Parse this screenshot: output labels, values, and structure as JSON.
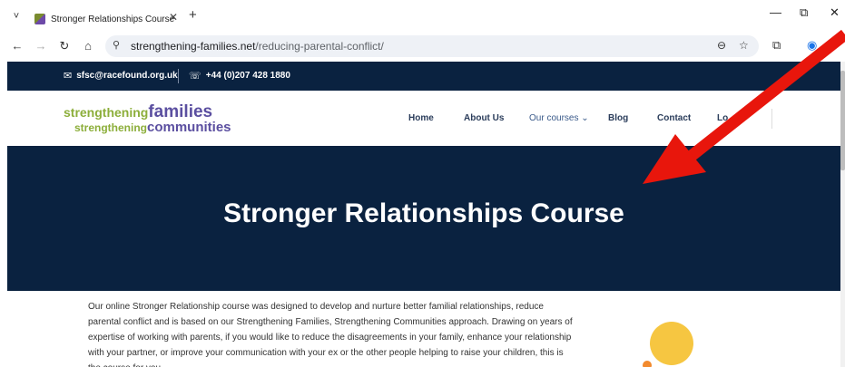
{
  "browser": {
    "tab_list_glyph": "˅",
    "tab_title": "Stronger Relationships Course",
    "tab_close_glyph": "✕",
    "new_tab_glyph": "+",
    "window_controls": {
      "minimize": "—",
      "restore": "⧉",
      "close": "✕"
    },
    "nav": {
      "back": "←",
      "forward": "→",
      "reload": "↻",
      "home": "⌂"
    },
    "site_info_glyph": "⚲",
    "url_host": "strengthening-families.net",
    "url_path": "/reducing-parental-conflict/",
    "zoom_glyph": "⊖",
    "bookmark_glyph": "☆",
    "extensions_glyph": "⧉",
    "profile_glyph": "◉"
  },
  "topbar": {
    "email": "sfsc@racefound.org.uk",
    "phone": "+44 (0)207 428 1880",
    "email_icon": "✉",
    "phone_icon": "☏"
  },
  "logo": {
    "line1_a": "strengthening",
    "line1_b": "families",
    "line2_a": "strengthening",
    "line2_b": "communities"
  },
  "nav": {
    "home": "Home",
    "about": "About Us",
    "courses": "Our courses",
    "courses_chevron": "⌄",
    "blog": "Blog",
    "contact": "Contact",
    "login": "Lo"
  },
  "hero": {
    "title": "Stronger Relationships Course"
  },
  "body": {
    "paragraph": "Our online Stronger Relationship course was designed to develop and nurture better familial relationships, reduce parental conflict and is based on our Strengthening Families, Strengthening Communities approach. Drawing on years of expertise of working with parents, if you would like to reduce the disagreements in your family, enhance your relationship with your partner, or improve your communication with your ex or the other people helping to raise your children, this is the course for you."
  },
  "colors": {
    "navy": "#0a2240",
    "logo_green": "#8cae3a",
    "logo_purple": "#5b4fa0",
    "arrow_red": "#e8160c",
    "circle_yellow": "#f6c641"
  }
}
